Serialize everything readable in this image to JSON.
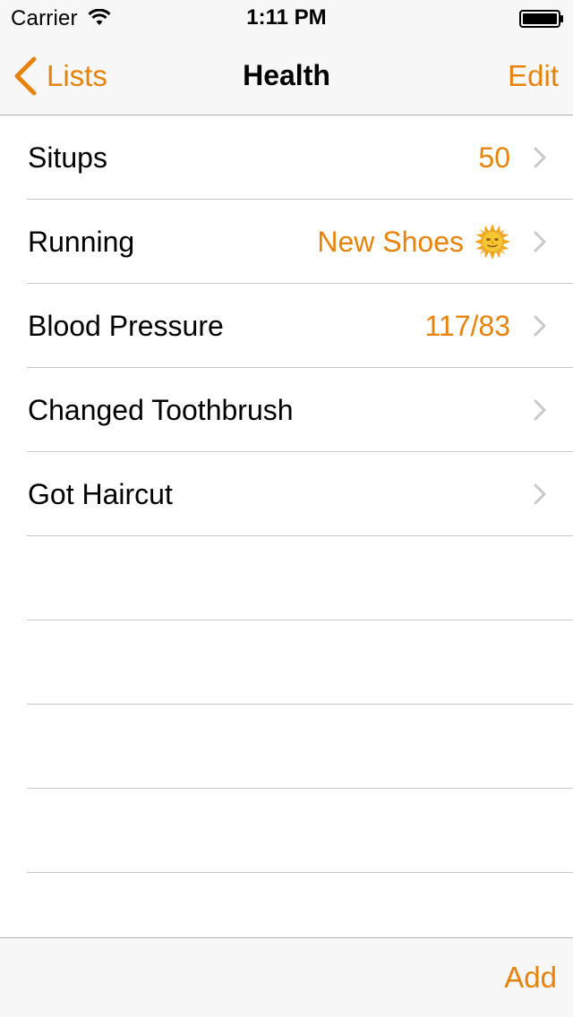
{
  "status_bar": {
    "carrier": "Carrier",
    "time": "1:11 PM"
  },
  "nav": {
    "back_label": "Lists",
    "title": "Health",
    "edit_label": "Edit"
  },
  "rows": [
    {
      "title": "Situps",
      "detail": "50",
      "icon": null
    },
    {
      "title": "Running",
      "detail": "New Shoes",
      "icon": "sun-face-icon"
    },
    {
      "title": "Blood Pressure",
      "detail": "117/83",
      "icon": null
    },
    {
      "title": "Changed Toothbrush",
      "detail": "",
      "icon": null
    },
    {
      "title": "Got Haircut",
      "detail": "",
      "icon": null
    }
  ],
  "toolbar": {
    "add_label": "Add"
  },
  "colors": {
    "accent": "#e8830a",
    "bar_background": "#f7f7f7",
    "separator": "#c8c7cc"
  }
}
